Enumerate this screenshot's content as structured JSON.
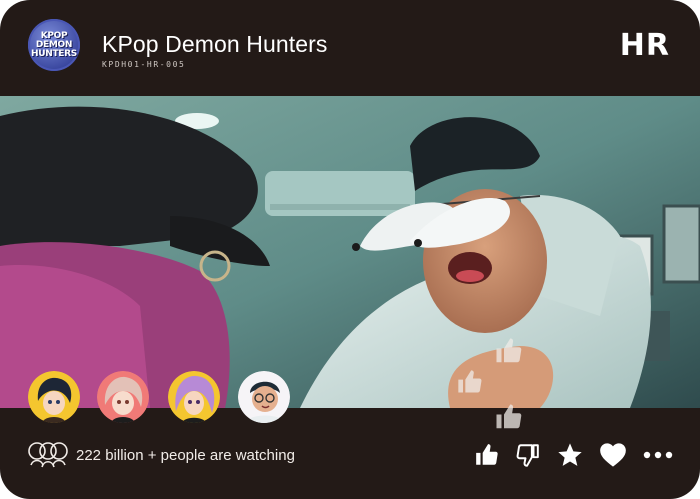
{
  "header": {
    "logo_lines": [
      "KPOP",
      "DEMON",
      "HUNTERS"
    ],
    "title": "KPop Demon Hunters",
    "code": "KPDH01-HR-005",
    "rarity": "HR"
  },
  "participants": [
    {
      "name": "participant-1",
      "icon": "avatar",
      "bg": "#f4c62f"
    },
    {
      "name": "participant-2",
      "icon": "avatar",
      "bg": "#f07a77"
    },
    {
      "name": "participant-3",
      "icon": "avatar",
      "bg": "#f4c62f"
    },
    {
      "name": "participant-4",
      "icon": "avatar",
      "bg": "#f6f4f7"
    }
  ],
  "footer": {
    "viewers_text": "222 billion + people are watching",
    "actions": [
      {
        "name": "like-button",
        "icon": "thumbs-up-icon"
      },
      {
        "name": "dislike-button",
        "icon": "thumbs-down-icon"
      },
      {
        "name": "favorite-button",
        "icon": "star-icon"
      },
      {
        "name": "love-button",
        "icon": "heart-icon"
      },
      {
        "name": "more-button",
        "icon": "more-icon"
      }
    ]
  },
  "colors": {
    "card_bg": "#231a17",
    "text": "#ffffff",
    "accent_logo": "#3b48a0"
  }
}
